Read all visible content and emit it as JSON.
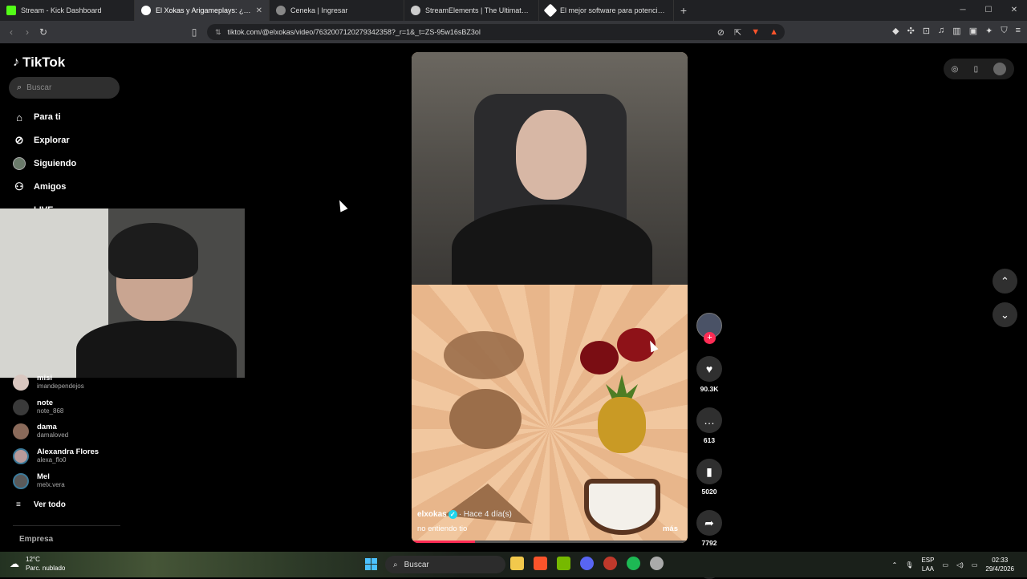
{
  "browser": {
    "tabs": [
      {
        "title": "Stream - Kick Dashboard",
        "color": "#53fc18"
      },
      {
        "title": "El Xokas y Arigameplays: ¿Un...",
        "color": "#ffffff",
        "active": true
      },
      {
        "title": "Ceneka | Ingresar",
        "color": "#888888"
      },
      {
        "title": "StreamElements | The Ultimate Strea...",
        "color": "#cccccc"
      },
      {
        "title": "El mejor software para potenciar tu s...",
        "color": "#ffffff"
      }
    ],
    "new_tab": "+",
    "url": "tiktok.com/@elxokas/video/7632007120279342358?_r=1&_t=ZS-95w16sBZ3ol"
  },
  "sidebar": {
    "logo": "TikTok",
    "search_placeholder": "Buscar",
    "nav": [
      {
        "label": "Para ti",
        "icon": "home-icon"
      },
      {
        "label": "Explorar",
        "icon": "compass-icon"
      },
      {
        "label": "Siguiendo",
        "icon": "avatar"
      },
      {
        "label": "Amigos",
        "icon": "friends-icon"
      },
      {
        "label": "LIVE",
        "icon": "live-icon"
      }
    ],
    "following": [
      {
        "name": "misi",
        "handle": "imandependejos"
      },
      {
        "name": "note",
        "handle": "note_868"
      },
      {
        "name": "dama",
        "handle": "damaloved"
      },
      {
        "name": "Alexandra Flores",
        "handle": "alexa_flo0"
      },
      {
        "name": "Mel",
        "handle": "melx.vera"
      }
    ],
    "see_all": "Ver todo",
    "footer": "Empresa"
  },
  "video": {
    "author": "elxokas",
    "time": "· Hace 4 día(s)",
    "description": "no entiendo tio",
    "more": "más",
    "progress": 0.23
  },
  "actions": {
    "likes": "90.3K",
    "comments": "613",
    "saves": "5020",
    "shares": "7792"
  },
  "taskbar": {
    "temp": "12°C",
    "weather": "Parc. nublado",
    "search": "Buscar",
    "lang1": "ESP",
    "lang2": "LAA",
    "time": "02:33",
    "date": "29/4/2026"
  }
}
